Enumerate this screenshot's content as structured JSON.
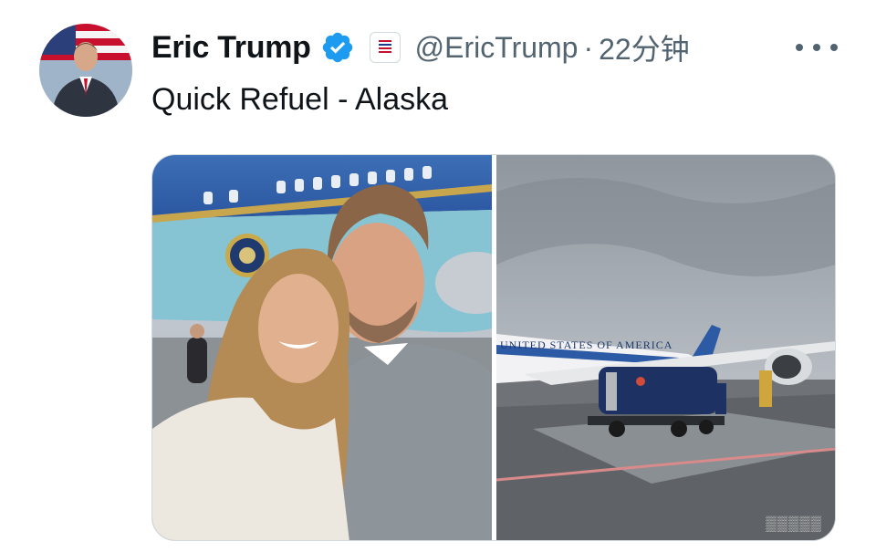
{
  "author": {
    "name": "Eric Trump",
    "handle": "@EricTrump",
    "separator": "·",
    "time": "22分钟",
    "verified_color": "#1d9bf0"
  },
  "tweet": {
    "text": "Quick Refuel - Alaska"
  },
  "photo2": {
    "fuselage_text": "UNITED STATES OF AMERICA"
  },
  "icons": {
    "verified": "verified-badge-icon",
    "affiliation": "government-affiliation-icon",
    "more": "more-horizontal-icon"
  }
}
